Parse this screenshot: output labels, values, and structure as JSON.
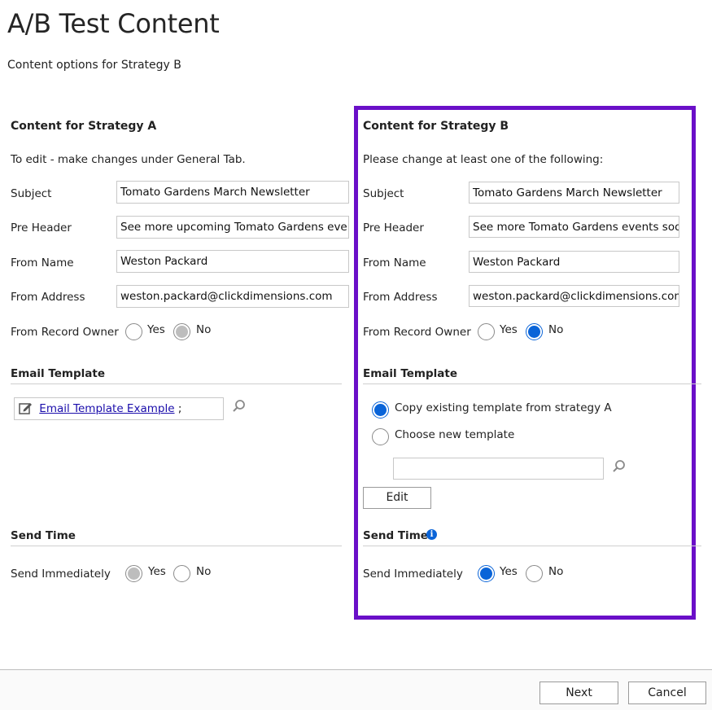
{
  "header": {
    "title": "A/B Test Content",
    "subtitle": "Content options for Strategy B"
  },
  "strategy_a": {
    "heading": "Content for Strategy A",
    "note": "To edit - make changes under General Tab.",
    "subject_label": "Subject",
    "subject_value": "Tomato Gardens March Newsletter",
    "preheader_label": "Pre Header",
    "preheader_value": "See more upcoming Tomato Gardens events",
    "from_name_label": "From Name",
    "from_name_value": "Weston Packard",
    "from_address_label": "From Address",
    "from_address_value": "weston.packard@clickdimensions.com",
    "record_owner_label": "From Record Owner",
    "record_owner_yes": "Yes",
    "record_owner_no": "No",
    "record_owner_selected": "No",
    "email_template_heading": "Email Template",
    "template_link": "Email Template Example",
    "template_suffix": ";",
    "send_time_heading": "Send Time",
    "send_immediately_label": "Send Immediately",
    "send_yes": "Yes",
    "send_no": "No",
    "send_selected": "Yes"
  },
  "strategy_b": {
    "heading": "Content for Strategy B",
    "note": "Please change at least one of the following:",
    "subject_label": "Subject",
    "subject_value": "Tomato Gardens March Newsletter",
    "preheader_label": "Pre Header",
    "preheader_value": "See more Tomato Gardens events soon!",
    "from_name_label": "From Name",
    "from_name_value": "Weston Packard",
    "from_address_label": "From Address",
    "from_address_value": "weston.packard@clickdimensions.com",
    "record_owner_label": "From Record Owner",
    "record_owner_yes": "Yes",
    "record_owner_no": "No",
    "record_owner_selected": "No",
    "email_template_heading": "Email Template",
    "copy_template_label": "Copy existing template from strategy A",
    "choose_template_label": "Choose new template",
    "template_option_selected": "copy",
    "template_lookup_value": "",
    "edit_button": "Edit",
    "send_time_heading": "Send Time",
    "send_immediately_label": "Send Immediately",
    "send_yes": "Yes",
    "send_no": "No",
    "send_selected": "Yes"
  },
  "footer": {
    "next_button": "Next",
    "cancel_button": "Cancel"
  },
  "colors": {
    "highlight_border": "#6a0fc8",
    "radio_selected": "#0a64d8",
    "radio_disabled_selected": "#bdbdbd",
    "link": "#1a0dab"
  },
  "icons": {
    "search": "search-icon",
    "edit_template": "edit-document-icon",
    "info": "info-icon"
  }
}
